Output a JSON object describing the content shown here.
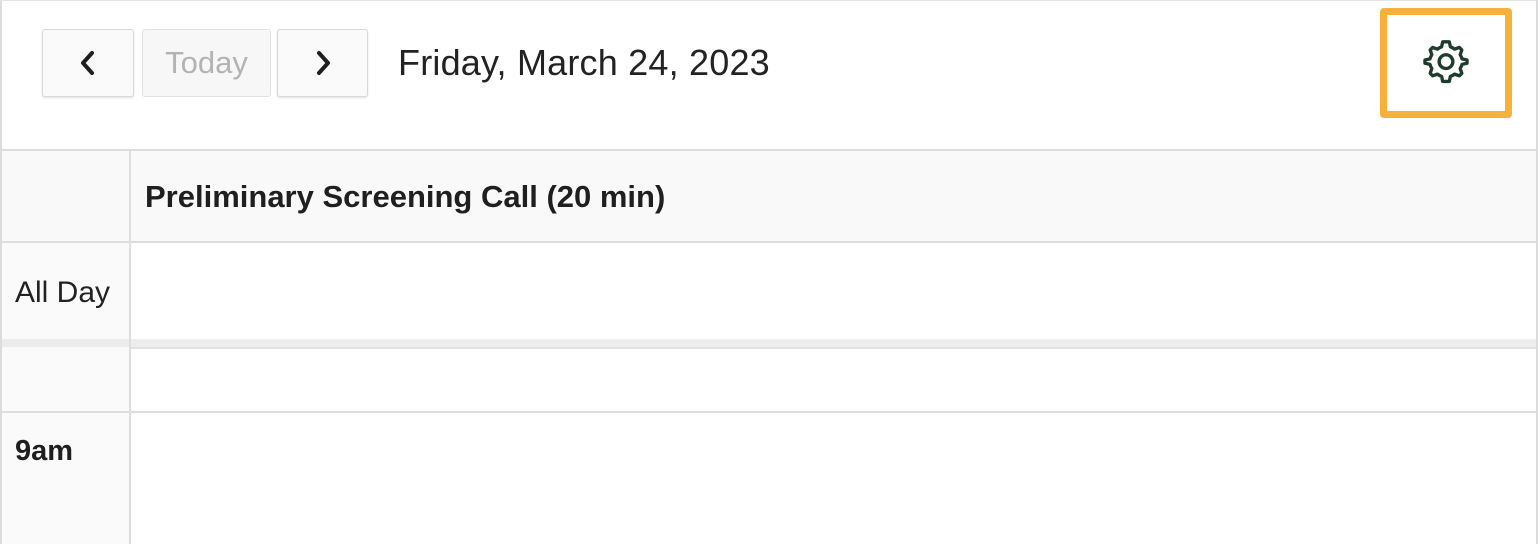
{
  "toolbar": {
    "prev_icon": "chevron-left-icon",
    "today_label": "Today",
    "next_icon": "chevron-right-icon",
    "date_title": "Friday, March 24, 2023",
    "settings_icon": "gear-icon"
  },
  "calendar": {
    "resource_column_title": "Preliminary Screening Call (20 min)",
    "all_day_label": "All Day",
    "time_labels": [
      "9am"
    ]
  },
  "colors": {
    "highlight": "#f6b13b",
    "gear": "#1e3b2c"
  }
}
